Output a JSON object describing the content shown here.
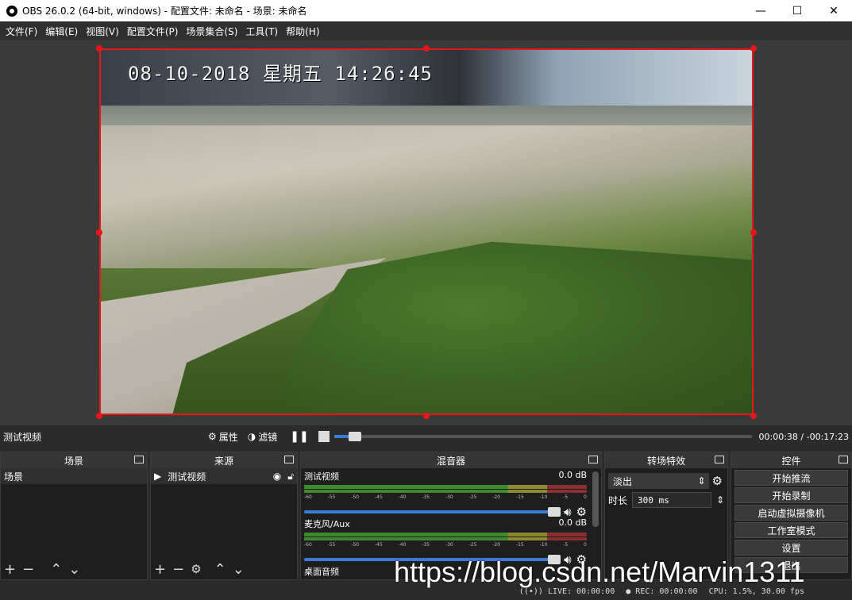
{
  "window": {
    "title": "OBS 26.0.2 (64-bit, windows) - 配置文件: 未命名 - 场景: 未命名",
    "minimize": "—",
    "maximize": "☐",
    "close": "✕"
  },
  "menu": [
    "文件(F)",
    "编辑(E)",
    "视图(V)",
    "配置文件(P)",
    "场景集合(S)",
    "工具(T)",
    "帮助(H)"
  ],
  "preview": {
    "osd_text": "08-10-2018 星期五 14:26:45",
    "selection_color": "#e8161b"
  },
  "source_bar": {
    "source_name": "测试视频",
    "properties": "属性",
    "filters": "滤镜",
    "time": "00:00:38 / -00:17:23",
    "seek_progress": 0.03
  },
  "docks": {
    "scenes": {
      "title": "场景",
      "items": [
        "场景"
      ]
    },
    "sources": {
      "title": "来源",
      "items": [
        "测试视频"
      ]
    },
    "mixer": {
      "title": "混音器",
      "channels": [
        {
          "name": "测试视频",
          "db": "0.0 dB",
          "volume": 1.0
        },
        {
          "name": "麦克风/Aux",
          "db": "0.0 dB",
          "volume": 1.0
        },
        {
          "name": "桌面音频",
          "db": ""
        }
      ],
      "ticks": [
        "-60",
        "-55",
        "-50",
        "-45",
        "-40",
        "-35",
        "-30",
        "-25",
        "-20",
        "-15",
        "-10",
        "-5",
        "0"
      ]
    },
    "transitions": {
      "title": "转场特效",
      "selected": "淡出",
      "duration_label": "时长",
      "duration_value": "300 ms"
    },
    "controls": {
      "title": "控件",
      "buttons": [
        "开始推流",
        "开始录制",
        "启动虚拟摄像机",
        "工作室模式",
        "设置",
        "退出"
      ]
    }
  },
  "status": {
    "live": "LIVE: 00:00:00",
    "rec": "REC: 00:00:00",
    "cpu": "CPU: 1.5%, 30.00 fps"
  },
  "watermark": "https://blog.csdn.net/Marvin1311"
}
